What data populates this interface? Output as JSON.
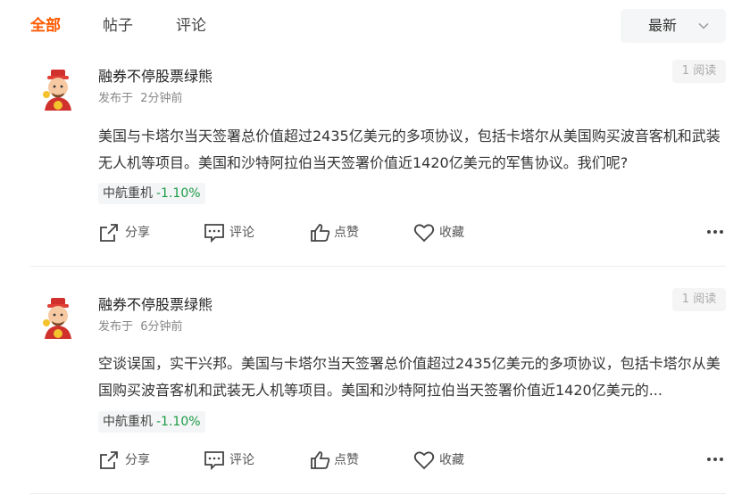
{
  "tabs": [
    {
      "label": "全部",
      "active": true
    },
    {
      "label": "帖子",
      "active": false
    },
    {
      "label": "评论",
      "active": false
    }
  ],
  "sort": {
    "selected": "最新",
    "icon": "chevron-down-icon"
  },
  "colors": {
    "accent": "#ff5a00",
    "down_green": "#1a9b45"
  },
  "posts": [
    {
      "author": "融券不停股票绿熊",
      "time": "发布于  2分钟前",
      "reads": "1 阅读",
      "body": "美国与卡塔尔当天签署总价值超过2435亿美元的多项协议，包括卡塔尔从美国购买波音客机和武装无人机等项目。美国和沙特阿拉伯当天签署价值近1420亿美元的军售协议。我们呢?",
      "stock": {
        "name": "中航重机",
        "change": "-1.10%"
      },
      "actions": {
        "share": "分享",
        "comment": "评论",
        "like": "点赞",
        "collect": "收藏"
      }
    },
    {
      "author": "融券不停股票绿熊",
      "time": "发布于  6分钟前",
      "reads": "1 阅读",
      "body": "空谈误国，实干兴邦。美国与卡塔尔当天签署总价值超过2435亿美元的多项协议，包括卡塔尔从美国购买波音客机和武装无人机等项目。美国和沙特阿拉伯当天签署价值近1420亿美元的...",
      "stock": {
        "name": "中航重机",
        "change": "-1.10%"
      },
      "actions": {
        "share": "分享",
        "comment": "评论",
        "like": "点赞",
        "collect": "收藏"
      }
    }
  ]
}
